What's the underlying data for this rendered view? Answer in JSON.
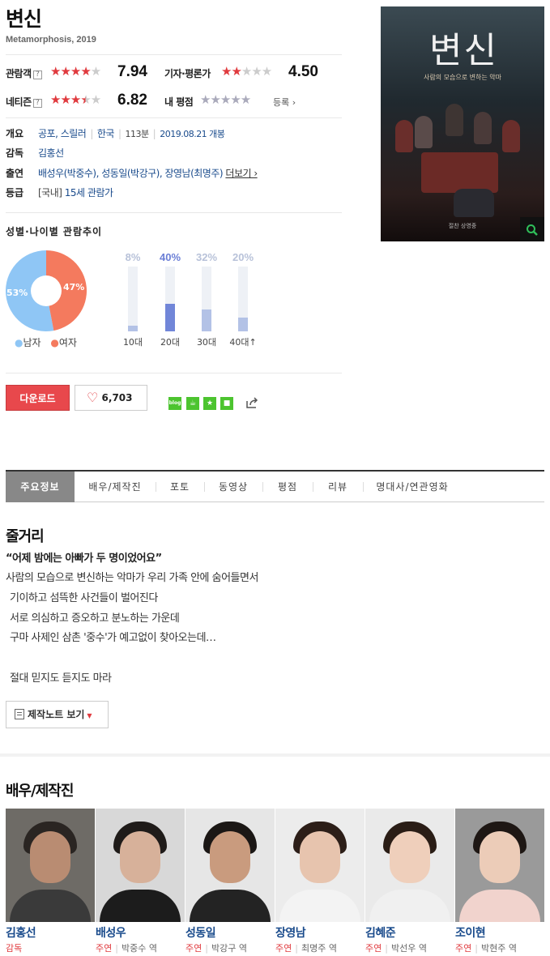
{
  "movie": {
    "title": "변신",
    "subtitle": "Metamorphosis, 2019"
  },
  "ratings": {
    "audience": {
      "label": "관람객",
      "score": "7.94",
      "stars_filled": 4
    },
    "critic": {
      "label": "기자·평론가",
      "score": "4.50",
      "stars_filled": 2
    },
    "netizen": {
      "label": "네티즌",
      "score": "6.82",
      "stars_filled": 3.5
    },
    "mine": {
      "label": "내 평점",
      "link": "등록 ›"
    },
    "help": "?"
  },
  "info": {
    "overview_label": "개요",
    "genre": "공포, 스릴러",
    "country": "한국",
    "runtime": "113분",
    "release": "2019.08.21 개봉",
    "director_label": "감독",
    "director": "김홍선",
    "cast_label": "출연",
    "cast_line": "배성우(박중수), 성동일(박강구), 장영남(최명주)",
    "more": "더보기 ›",
    "grade_label": "등급",
    "grade_prefix": "[국내]",
    "grade": "15세 관람가"
  },
  "poster": {
    "title_text": "변신",
    "tagline": "사람의 모습으로 변하는 악마",
    "credit": "절찬 상영중",
    "zoom_icon": "search-icon"
  },
  "trend": {
    "title": "성별·나이별 관람추이",
    "gender": {
      "male_pct": "53%",
      "female_pct": "47%",
      "male_value": 53,
      "female_value": 47,
      "male_label": "남자",
      "female_label": "여자",
      "male_color": "#8fc6f5",
      "female_color": "#f47a5e"
    },
    "age": [
      {
        "label": "10대",
        "pct": "8%",
        "value": 8
      },
      {
        "label": "20대",
        "pct": "40%",
        "value": 40
      },
      {
        "label": "30대",
        "pct": "32%",
        "value": 32
      },
      {
        "label": "40대↑",
        "pct": "20%",
        "value": 20
      }
    ]
  },
  "actions": {
    "download": "다운로드",
    "like_count": "6,703",
    "share_icons": [
      "blog-icon",
      "cafe-icon",
      "favorite-icon",
      "me2day-icon",
      "share-icon"
    ],
    "blog_text": "blog"
  },
  "tabs": [
    "주요정보",
    "배우/제작진",
    "포토",
    "동영상",
    "평점",
    "리뷰",
    "명대사/연관영화"
  ],
  "synopsis": {
    "heading": "줄거리",
    "quote": "“어제 밤에는 아빠가 두 명이었어요”",
    "lines": [
      "사람의 모습으로 변신하는 악마가 우리 가족 안에 숨어들면서",
      "기이하고 섬뜩한 사건들이 벌어진다",
      "서로 의심하고 증오하고 분노하는 가운데",
      "구마 사제인 삼촌 '중수'가 예고없이 찾아오는데…",
      "",
      "절대 믿지도 듣지도 마라"
    ],
    "note_button": "제작노트 보기"
  },
  "cast_section": {
    "heading": "배우/제작진",
    "people": [
      {
        "name": "김홍선",
        "role": "감독",
        "char": ""
      },
      {
        "name": "배성우",
        "role": "주연",
        "char": "박중수 역"
      },
      {
        "name": "성동일",
        "role": "주연",
        "char": "박강구 역"
      },
      {
        "name": "장영남",
        "role": "주연",
        "char": "최명주 역"
      },
      {
        "name": "김혜준",
        "role": "주연",
        "char": "박선우 역"
      },
      {
        "name": "조이현",
        "role": "주연",
        "char": "박현주 역"
      }
    ]
  }
}
